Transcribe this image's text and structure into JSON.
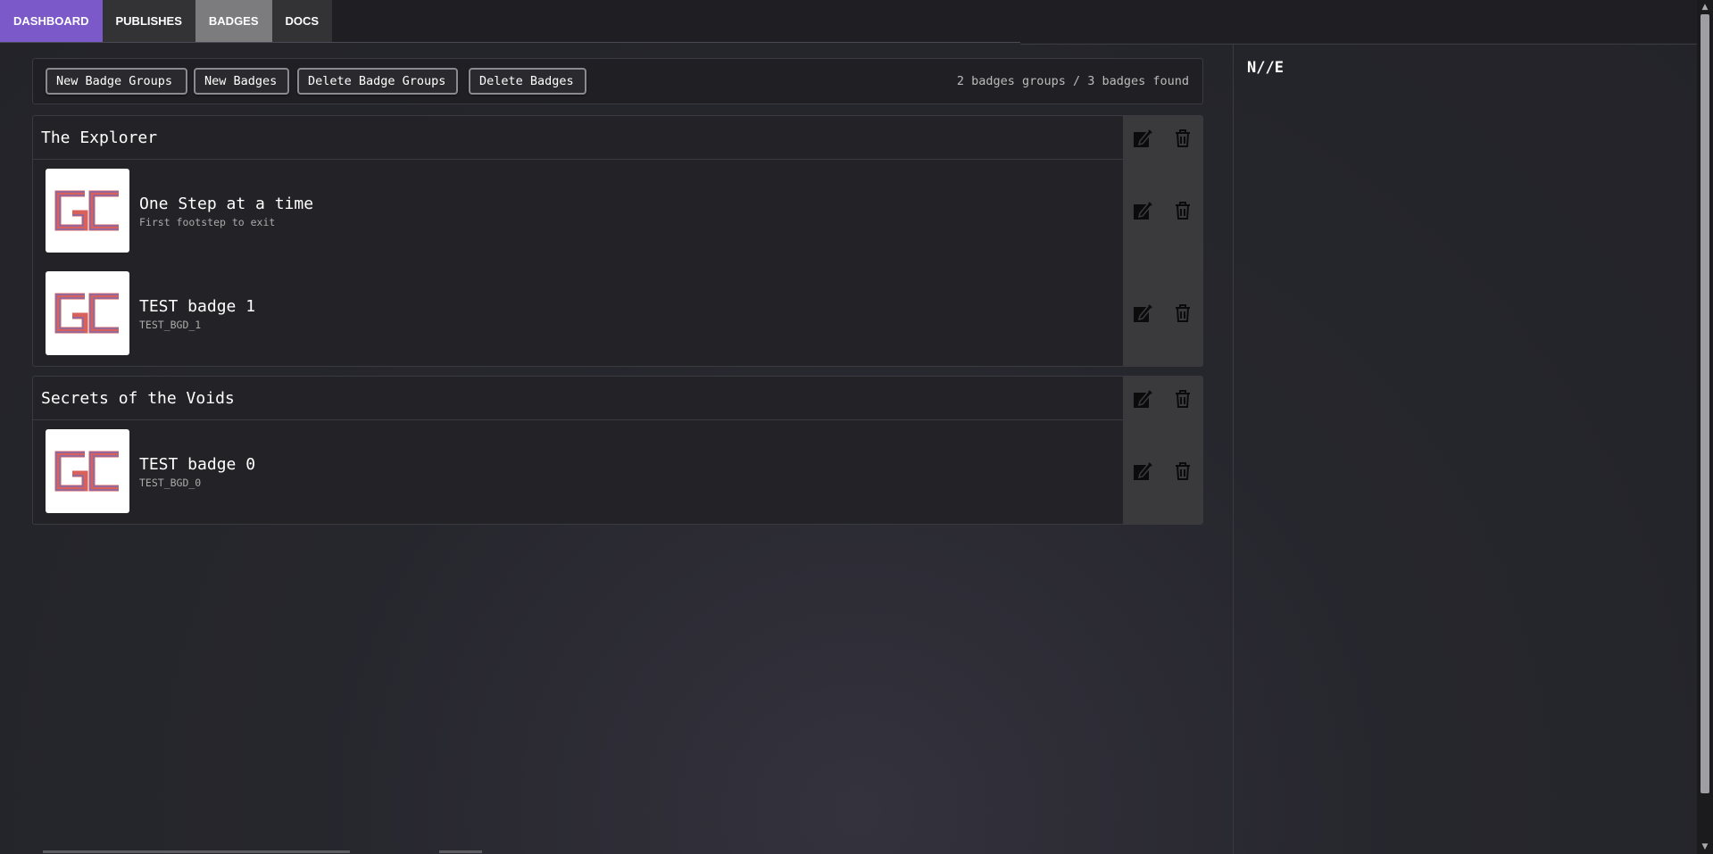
{
  "nav": {
    "tabs": [
      {
        "label": "DASHBOARD"
      },
      {
        "label": "PUBLISHES"
      },
      {
        "label": "BADGES"
      },
      {
        "label": "DOCS"
      }
    ]
  },
  "toolbar": {
    "new_groups": "New Badge Groups",
    "new_badges": "New Badges",
    "delete_groups": "Delete Badge Groups",
    "delete_badges": "Delete Badges",
    "count": "2 badges groups / 3 badges found"
  },
  "groups": [
    {
      "title": "The Explorer",
      "badges": [
        {
          "name": "One Step at a time",
          "desc": "First footstep to exit"
        },
        {
          "name": "TEST badge 1",
          "desc": "TEST_BGD_1"
        }
      ]
    },
    {
      "title": "Secrets of the Voids",
      "badges": [
        {
          "name": "TEST badge 0",
          "desc": "TEST_BGD_0"
        }
      ]
    }
  ],
  "side_panel": {
    "text": "N//E"
  },
  "icons": {
    "edit": "edit-icon",
    "delete": "trash-icon",
    "badge_image": "gc-logo"
  },
  "colors": {
    "accent": "#7b59c9",
    "selected_tab": "#7c7c7e",
    "action_column": "#3a3a3c"
  }
}
